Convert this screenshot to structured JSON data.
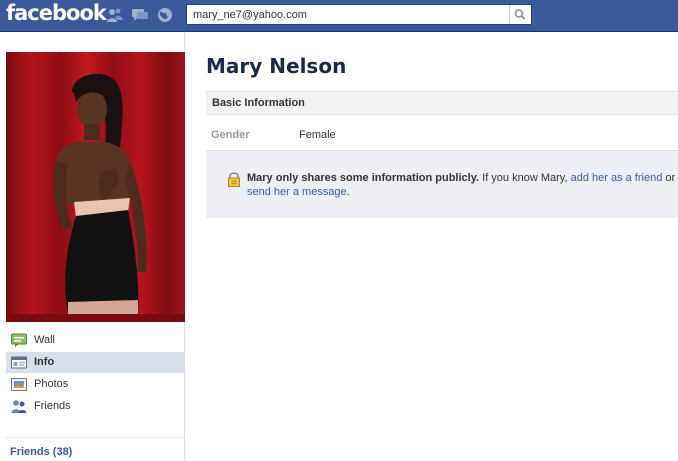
{
  "header": {
    "logo": "facebook",
    "search_value": "mary_ne7@yahoo.com",
    "jewels": [
      "friend-requests-icon",
      "messages-icon",
      "notifications-globe-icon"
    ],
    "brand_color": "#3b5998"
  },
  "sidebar": {
    "items": [
      {
        "label": "Wall",
        "icon": "wall-icon"
      },
      {
        "label": "Info",
        "icon": "info-icon",
        "active": true
      },
      {
        "label": "Photos",
        "icon": "photos-icon"
      },
      {
        "label": "Friends",
        "icon": "friends-icon"
      }
    ],
    "friends_link": "Friends (38)"
  },
  "profile": {
    "name": "Mary Nelson",
    "section_title": "Basic Information",
    "gender_label": "Gender",
    "gender_value": "Female"
  },
  "privacy_notice": {
    "bold": "Mary only shares some information publicly.",
    "text_before_link": " If you know Mary, ",
    "link1": "add her as a friend",
    "text_between": " or ",
    "link2": "send her a message",
    "text_after": "."
  }
}
